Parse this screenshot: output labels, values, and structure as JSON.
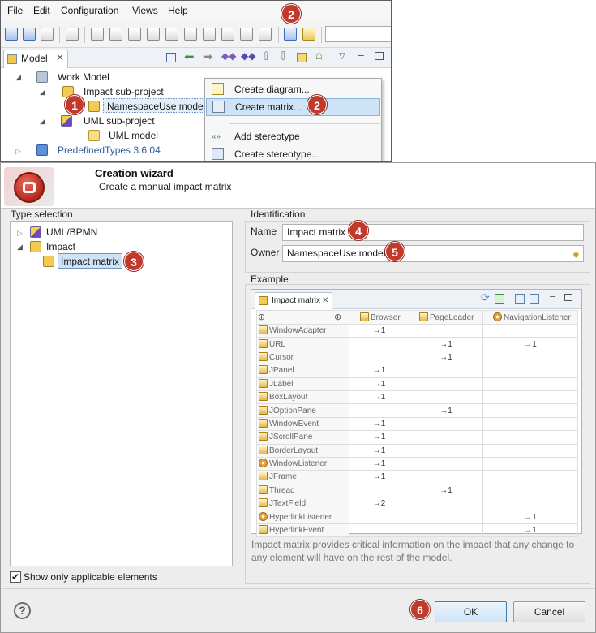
{
  "ide": {
    "menu": [
      "File",
      "Edit",
      "Configuration",
      "Views",
      "Help"
    ],
    "model_tab": "Model",
    "tree": [
      {
        "label": "Work Model"
      },
      {
        "label": "Impact sub-project"
      },
      {
        "label": "NamespaceUse model"
      },
      {
        "label": "UML sub-project"
      },
      {
        "label": "UML model"
      },
      {
        "label": "PredefinedTypes 3.6.04"
      }
    ],
    "context_menu": [
      "Create diagram...",
      "Create matrix...",
      "Add stereotype",
      "Create stereotype..."
    ]
  },
  "wizard": {
    "title": "Creation wizard",
    "subtitle": "Create a manual impact matrix",
    "type_selection": {
      "label": "Type selection",
      "items": [
        "UML/BPMN",
        "Impact",
        "Impact matrix"
      ]
    },
    "show_only_applicable": {
      "label": "Show only applicable elements",
      "checked": true
    },
    "identification": {
      "label": "Identification",
      "name_label": "Name",
      "name_value": "Impact matrix",
      "owner_label": "Owner",
      "owner_value": "NamespaceUse model"
    },
    "example": {
      "label": "Example",
      "tab_label": "Impact matrix",
      "columns": [
        "Browser",
        "PageLoader",
        "NavigationListener"
      ],
      "rows": [
        {
          "name": "WindowAdapter",
          "icon": "class-icon",
          "cells": [
            "→1",
            "",
            ""
          ]
        },
        {
          "name": "URL",
          "icon": "class-icon",
          "cells": [
            "",
            "→1",
            "→1"
          ]
        },
        {
          "name": "Cursor",
          "icon": "class-icon",
          "cells": [
            "",
            "→1",
            ""
          ]
        },
        {
          "name": "JPanel",
          "icon": "class-icon",
          "cells": [
            "→1",
            "",
            ""
          ]
        },
        {
          "name": "JLabel",
          "icon": "class-icon",
          "cells": [
            "→1",
            "",
            ""
          ]
        },
        {
          "name": "BoxLayout",
          "icon": "class-icon",
          "cells": [
            "→1",
            "",
            ""
          ]
        },
        {
          "name": "JOptionPane",
          "icon": "class-icon",
          "cells": [
            "",
            "→1",
            ""
          ]
        },
        {
          "name": "WindowEvent",
          "icon": "class-icon",
          "cells": [
            "→1",
            "",
            ""
          ]
        },
        {
          "name": "JScrollPane",
          "icon": "class-icon",
          "cells": [
            "→1",
            "",
            ""
          ]
        },
        {
          "name": "BorderLayout",
          "icon": "class-icon",
          "cells": [
            "→1",
            "",
            ""
          ]
        },
        {
          "name": "WindowListener",
          "icon": "interface-icon",
          "cells": [
            "→1",
            "",
            ""
          ]
        },
        {
          "name": "JFrame",
          "icon": "class-icon",
          "cells": [
            "→1",
            "",
            ""
          ]
        },
        {
          "name": "Thread",
          "icon": "class-icon",
          "cells": [
            "",
            "→1",
            ""
          ]
        },
        {
          "name": "JTextField",
          "icon": "class-icon",
          "cells": [
            "→2",
            "",
            ""
          ]
        },
        {
          "name": "HyperlinkListener",
          "icon": "interface-icon",
          "cells": [
            "",
            "",
            "→1"
          ]
        },
        {
          "name": "HyperlinkEvent",
          "icon": "class-icon",
          "cells": [
            "",
            "",
            "→1"
          ]
        }
      ]
    },
    "description": "Impact matrix provides critical information on the impact that any change to any element will have on the rest of the model.",
    "buttons": {
      "help": "?",
      "ok": "OK",
      "cancel": "Cancel"
    }
  },
  "badges": [
    "1",
    "2",
    "2",
    "3",
    "4",
    "5",
    "6"
  ],
  "colors": {
    "badge": "#c0392b",
    "selection": "#cfe3f7",
    "link_blue": "#2f5f9e"
  }
}
